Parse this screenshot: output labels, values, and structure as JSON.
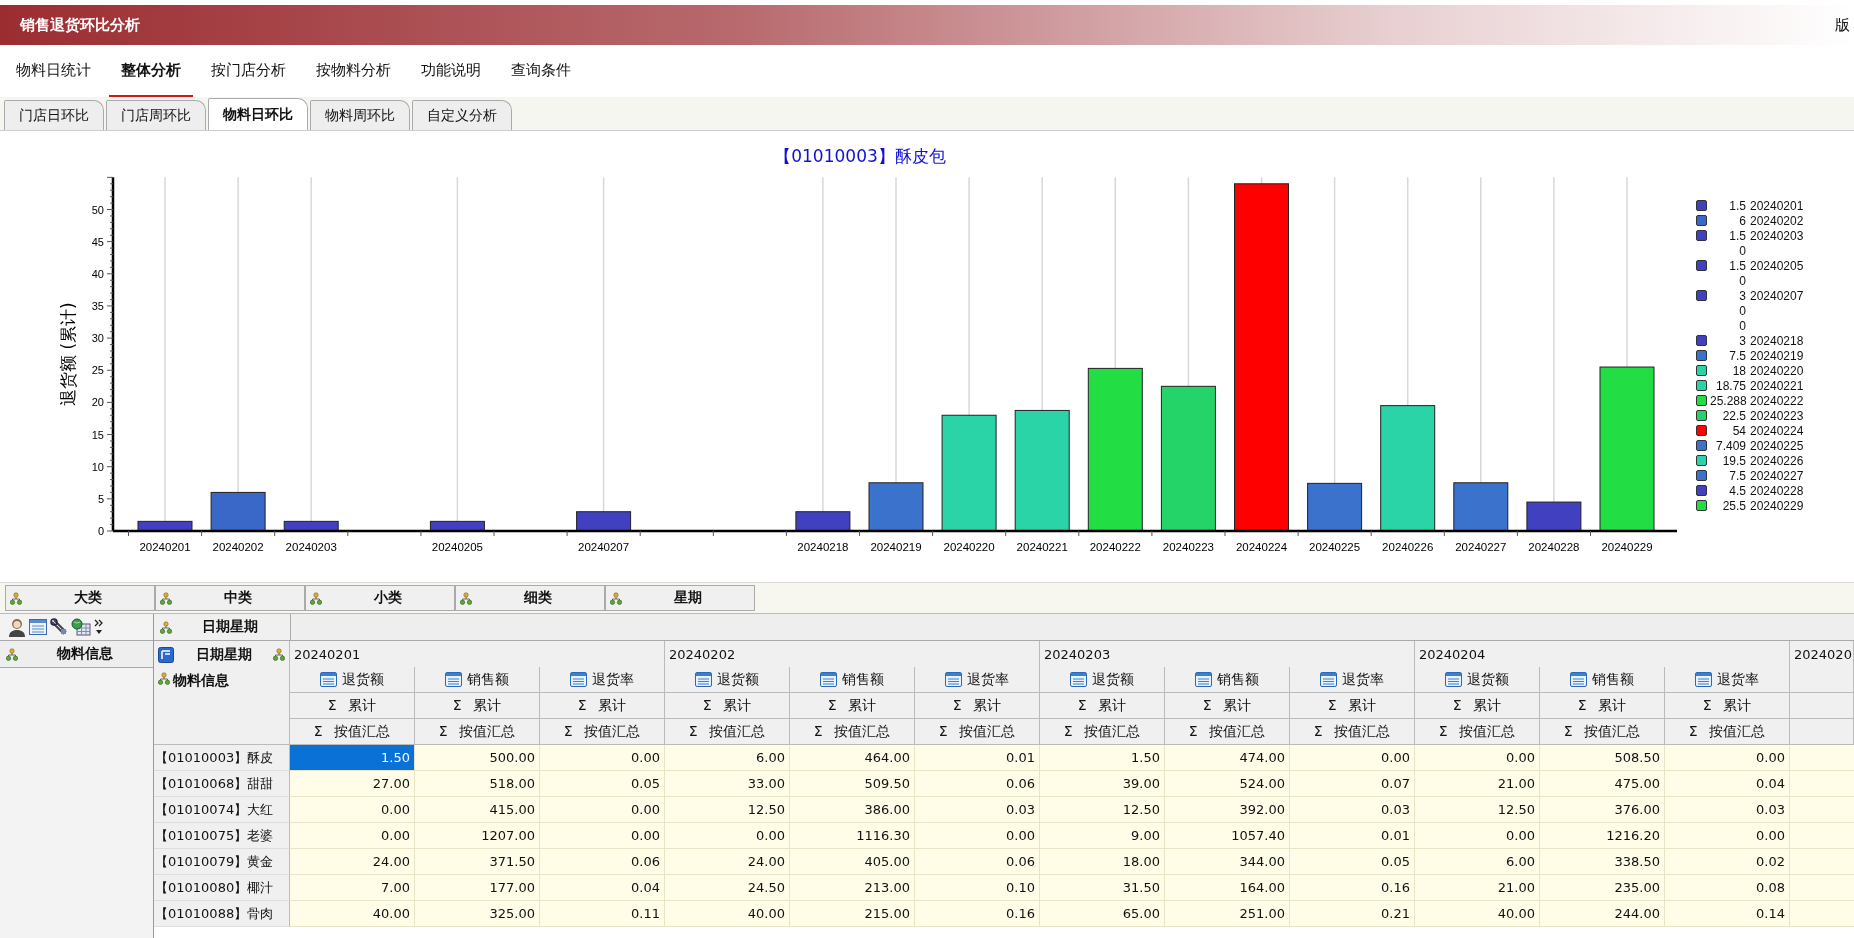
{
  "window": {
    "title": "销售退货环比分析",
    "corner_text": "版"
  },
  "menu": [
    {
      "label": "物料日统计",
      "selected": false
    },
    {
      "label": "整体分析",
      "selected": true
    },
    {
      "label": "按门店分析",
      "selected": false
    },
    {
      "label": "按物料分析",
      "selected": false
    },
    {
      "label": "功能说明",
      "selected": false
    },
    {
      "label": "查询条件",
      "selected": false
    }
  ],
  "subtabs": [
    {
      "label": "门店日环比",
      "selected": false
    },
    {
      "label": "门店周环比",
      "selected": false
    },
    {
      "label": "物料日环比",
      "selected": true
    },
    {
      "label": "物料周环比",
      "selected": false
    },
    {
      "label": "自定义分析",
      "selected": false
    }
  ],
  "chart": {
    "chart_data": {
      "type": "bar",
      "title": "【01010003】酥皮包",
      "ylabel": "退货额 (累计)",
      "categories": [
        "20240201",
        "20240202",
        "20240203",
        null,
        "20240205",
        null,
        "20240207",
        null,
        null,
        "20240218",
        "20240219",
        "20240220",
        "20240221",
        "20240222",
        "20240223",
        "20240224",
        "20240225",
        "20240226",
        "20240227",
        "20240228",
        "20240229"
      ],
      "series": [
        {
          "values": [
            1.5,
            6,
            1.5,
            0,
            1.5,
            0,
            3,
            0,
            0,
            3,
            7.5,
            18,
            18.75,
            25.288,
            22.5,
            54,
            7.409,
            19.5,
            7.5,
            4.5,
            25.5
          ]
        }
      ],
      "grid": true,
      "ylim": [
        0,
        55
      ],
      "yticks": [
        0,
        5,
        10,
        15,
        20,
        25,
        30,
        35,
        40,
        45,
        50
      ]
    },
    "legend": [
      {
        "value": "1.5",
        "date": "20240201",
        "color": "#4040c0"
      },
      {
        "value": "6",
        "date": "20240202",
        "color": "#3a68c8"
      },
      {
        "value": "1.5",
        "date": "20240203",
        "color": "#4040c0"
      },
      {
        "value": "0"
      },
      {
        "value": "1.5",
        "date": "20240205",
        "color": "#4040c0"
      },
      {
        "value": "0"
      },
      {
        "value": "3",
        "date": "20240207",
        "color": "#4040c0"
      },
      {
        "value": "0"
      },
      {
        "value": "0"
      },
      {
        "value": "3",
        "date": "20240218",
        "color": "#4040c0"
      },
      {
        "value": "7.5",
        "date": "20240219",
        "color": "#3a72cc"
      },
      {
        "value": "18",
        "date": "20240220",
        "color": "#2bd4a6"
      },
      {
        "value": "18.75",
        "date": "20240221",
        "color": "#2bd4a6"
      },
      {
        "value": "25.288",
        "date": "20240222",
        "color": "#22dd44"
      },
      {
        "value": "22.5",
        "date": "20240223",
        "color": "#25d468"
      },
      {
        "value": "54",
        "date": "20240224",
        "color": "#ff0000"
      },
      {
        "value": "7.409",
        "date": "20240225",
        "color": "#3a72cc"
      },
      {
        "value": "19.5",
        "date": "20240226",
        "color": "#2bd4a6"
      },
      {
        "value": "7.5",
        "date": "20240227",
        "color": "#3a72cc"
      },
      {
        "value": "4.5",
        "date": "20240228",
        "color": "#4040c0"
      },
      {
        "value": "25.5",
        "date": "20240229",
        "color": "#22dd44"
      }
    ]
  },
  "pivot": {
    "filter_fields": [
      "大类",
      "中类",
      "小类",
      "细类",
      "星期"
    ],
    "column_field": "日期星期",
    "row_field": "物料信息",
    "corner_column_label": "日期星期",
    "corner_row_label": "物料信息",
    "date_groups": [
      {
        "date": "20240201",
        "measures": [
          {
            "name": "退货额",
            "sum": "Σ 累计",
            "agg": "Σ 按值汇总"
          },
          {
            "name": "销售额",
            "sum": "Σ 累计",
            "agg": "Σ 按值汇总"
          },
          {
            "name": "退货率",
            "sum": "Σ 累计",
            "agg": "Σ 按值汇总"
          }
        ]
      },
      {
        "date": "20240202",
        "measures": [
          {
            "name": "退货额",
            "sum": "Σ 累计",
            "agg": "Σ 按值汇总"
          },
          {
            "name": "销售额",
            "sum": "Σ 累计",
            "agg": "Σ 按值汇总"
          },
          {
            "name": "退货率",
            "sum": "Σ 累计",
            "agg": "Σ 按值汇总"
          }
        ]
      },
      {
        "date": "20240203",
        "measures": [
          {
            "name": "退货额",
            "sum": "Σ 累计",
            "agg": "Σ 按值汇总"
          },
          {
            "name": "销售额",
            "sum": "Σ 累计",
            "agg": "Σ 按值汇总"
          },
          {
            "name": "退货率",
            "sum": "Σ 累计",
            "agg": "Σ 按值汇总"
          }
        ]
      },
      {
        "date": "20240204",
        "measures": [
          {
            "name": "退货额",
            "sum": "Σ 累计",
            "agg": "Σ 按值汇总"
          },
          {
            "name": "销售额",
            "sum": "Σ 累计",
            "agg": "Σ 按值汇总"
          },
          {
            "name": "退货率",
            "sum": "Σ 累计",
            "agg": "Σ 按值汇总"
          }
        ]
      }
    ],
    "partial_date": "2024020",
    "rows": [
      {
        "label": "【01010003】酥皮",
        "cells": [
          {
            "text": "1.50",
            "selected": true
          },
          {
            "text": "500.00",
            "selected": false
          },
          {
            "text": "0.00",
            "selected": false
          },
          {
            "text": "6.00",
            "selected": false
          },
          {
            "text": "464.00",
            "selected": false
          },
          {
            "text": "0.01",
            "selected": false
          },
          {
            "text": "1.50",
            "selected": false
          },
          {
            "text": "474.00",
            "selected": false
          },
          {
            "text": "0.00",
            "selected": false
          },
          {
            "text": "0.00",
            "selected": false
          },
          {
            "text": "508.50",
            "selected": false
          },
          {
            "text": "0.00",
            "selected": false
          }
        ]
      },
      {
        "label": "【01010068】甜甜",
        "cells": [
          {
            "text": "27.00",
            "selected": false
          },
          {
            "text": "518.00",
            "selected": false
          },
          {
            "text": "0.05",
            "selected": false
          },
          {
            "text": "33.00",
            "selected": false
          },
          {
            "text": "509.50",
            "selected": false
          },
          {
            "text": "0.06",
            "selected": false
          },
          {
            "text": "39.00",
            "selected": false
          },
          {
            "text": "524.00",
            "selected": false
          },
          {
            "text": "0.07",
            "selected": false
          },
          {
            "text": "21.00",
            "selected": false
          },
          {
            "text": "475.00",
            "selected": false
          },
          {
            "text": "0.04",
            "selected": false
          }
        ]
      },
      {
        "label": "【01010074】大红",
        "cells": [
          {
            "text": "0.00",
            "selected": false
          },
          {
            "text": "415.00",
            "selected": false
          },
          {
            "text": "0.00",
            "selected": false
          },
          {
            "text": "12.50",
            "selected": false
          },
          {
            "text": "386.00",
            "selected": false
          },
          {
            "text": "0.03",
            "selected": false
          },
          {
            "text": "12.50",
            "selected": false
          },
          {
            "text": "392.00",
            "selected": false
          },
          {
            "text": "0.03",
            "selected": false
          },
          {
            "text": "12.50",
            "selected": false
          },
          {
            "text": "376.00",
            "selected": false
          },
          {
            "text": "0.03",
            "selected": false
          }
        ]
      },
      {
        "label": "【01010075】老婆",
        "cells": [
          {
            "text": "0.00",
            "selected": false
          },
          {
            "text": "1207.00",
            "selected": false
          },
          {
            "text": "0.00",
            "selected": false
          },
          {
            "text": "0.00",
            "selected": false
          },
          {
            "text": "1116.30",
            "selected": false
          },
          {
            "text": "0.00",
            "selected": false
          },
          {
            "text": "9.00",
            "selected": false
          },
          {
            "text": "1057.40",
            "selected": false
          },
          {
            "text": "0.01",
            "selected": false
          },
          {
            "text": "0.00",
            "selected": false
          },
          {
            "text": "1216.20",
            "selected": false
          },
          {
            "text": "0.00",
            "selected": false
          }
        ]
      },
      {
        "label": "【01010079】黄金",
        "cells": [
          {
            "text": "24.00",
            "selected": false
          },
          {
            "text": "371.50",
            "selected": false
          },
          {
            "text": "0.06",
            "selected": false
          },
          {
            "text": "24.00",
            "selected": false
          },
          {
            "text": "405.00",
            "selected": false
          },
          {
            "text": "0.06",
            "selected": false
          },
          {
            "text": "18.00",
            "selected": false
          },
          {
            "text": "344.00",
            "selected": false
          },
          {
            "text": "0.05",
            "selected": false
          },
          {
            "text": "6.00",
            "selected": false
          },
          {
            "text": "338.50",
            "selected": false
          },
          {
            "text": "0.02",
            "selected": false
          }
        ]
      },
      {
        "label": "【01010080】椰汁",
        "cells": [
          {
            "text": "7.00",
            "selected": false
          },
          {
            "text": "177.00",
            "selected": false
          },
          {
            "text": "0.04",
            "selected": false
          },
          {
            "text": "24.50",
            "selected": false
          },
          {
            "text": "213.00",
            "selected": false
          },
          {
            "text": "0.10",
            "selected": false
          },
          {
            "text": "31.50",
            "selected": false
          },
          {
            "text": "164.00",
            "selected": false
          },
          {
            "text": "0.16",
            "selected": false
          },
          {
            "text": "21.00",
            "selected": false
          },
          {
            "text": "235.00",
            "selected": false
          },
          {
            "text": "0.08",
            "selected": false
          }
        ]
      },
      {
        "label": "【01010088】骨肉",
        "cells": [
          {
            "text": "40.00",
            "selected": false
          },
          {
            "text": "325.00",
            "selected": false
          },
          {
            "text": "0.11",
            "selected": false
          },
          {
            "text": "40.00",
            "selected": false
          },
          {
            "text": "215.00",
            "selected": false
          },
          {
            "text": "0.16",
            "selected": false
          },
          {
            "text": "65.00",
            "selected": false
          },
          {
            "text": "251.00",
            "selected": false
          },
          {
            "text": "0.21",
            "selected": false
          },
          {
            "text": "40.00",
            "selected": false
          },
          {
            "text": "244.00",
            "selected": false
          },
          {
            "text": "0.14",
            "selected": false
          }
        ]
      }
    ]
  }
}
